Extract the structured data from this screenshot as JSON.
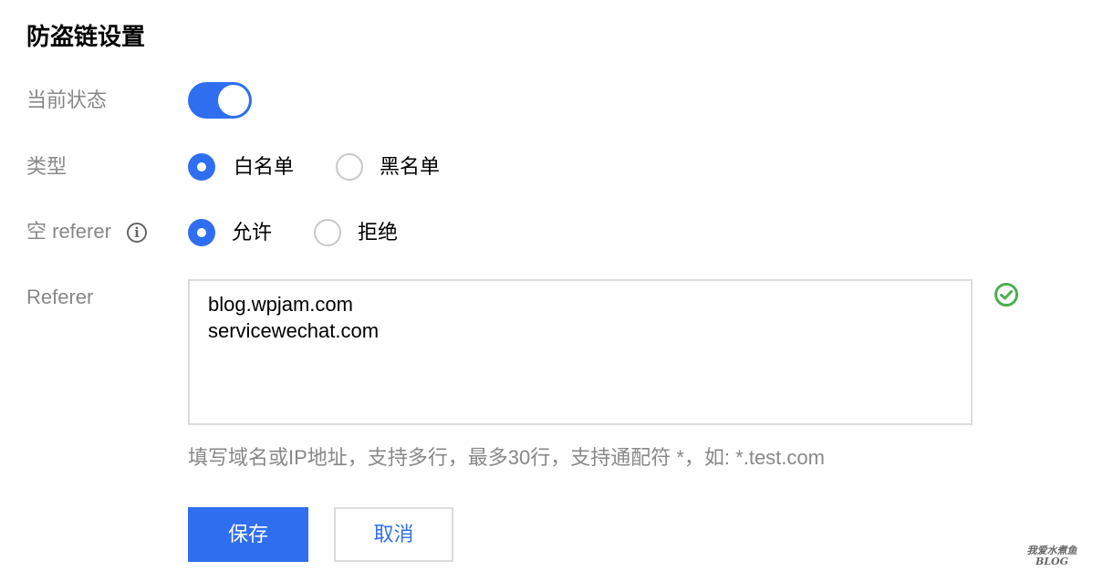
{
  "page_title": "防盗链设置",
  "status": {
    "label": "当前状态",
    "enabled": true
  },
  "type": {
    "label": "类型",
    "options": [
      {
        "label": "白名单",
        "checked": true
      },
      {
        "label": "黑名单",
        "checked": false
      }
    ]
  },
  "empty_referer": {
    "label": "空 referer",
    "info_icon": "info-icon",
    "options": [
      {
        "label": "允许",
        "checked": true
      },
      {
        "label": "拒绝",
        "checked": false
      }
    ]
  },
  "referer": {
    "label": "Referer",
    "value": "blog.wpjam.com\nservicewechat.com",
    "valid_icon": "check-circle-icon",
    "valid_color": "#4caf50",
    "hint": "填写域名或IP地址，支持多行，最多30行，支持通配符 *，如: *.test.com"
  },
  "buttons": {
    "save": "保存",
    "cancel": "取消"
  },
  "watermark": {
    "line1": "我爱水煮鱼",
    "line2": "BLOG"
  },
  "colors": {
    "accent": "#2f6fef",
    "label": "#888888",
    "border": "#dcdcdc"
  }
}
